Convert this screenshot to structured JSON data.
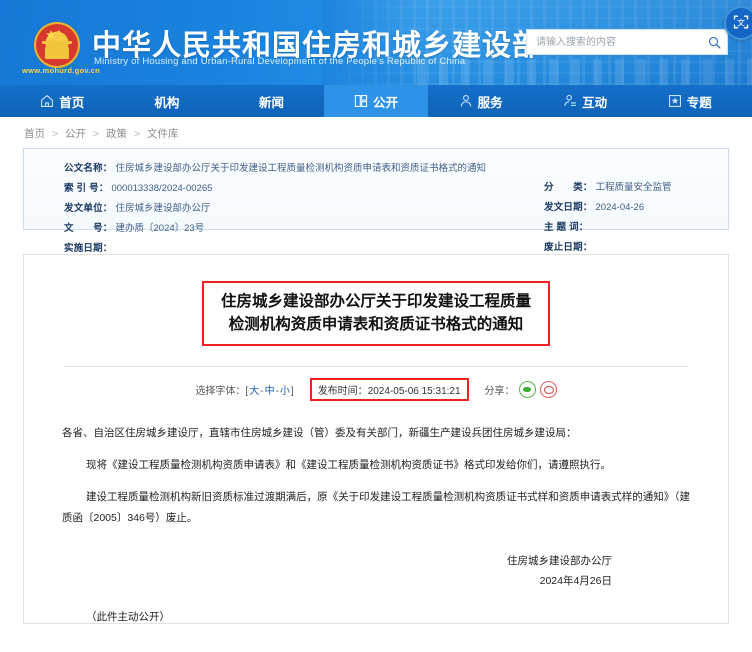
{
  "header": {
    "site_title": "中华人民共和国住房和城乡建设部",
    "site_subtitle": "Ministry of Housing and Urban-Rural Development of the People's Republic of China",
    "site_url": "www.mohurd.gov.cn",
    "emblem_name": "national-emblem",
    "search_placeholder": "请输入搜索的内容",
    "search_value": "",
    "search_icon": "search-icon",
    "corner_button_icon": "scan-text-icon",
    "corner_button_label": "文"
  },
  "nav": {
    "items": [
      {
        "label": "首页",
        "icon": "home-icon",
        "active": false
      },
      {
        "label": "机构",
        "icon": "none",
        "active": false
      },
      {
        "label": "新闻",
        "icon": "none",
        "active": false
      },
      {
        "label": "公开",
        "icon": "document-open-icon",
        "active": true
      },
      {
        "label": "服务",
        "icon": "user-service-icon",
        "active": false
      },
      {
        "label": "互动",
        "icon": "interaction-icon",
        "active": false
      },
      {
        "label": "专题",
        "icon": "star-box-icon",
        "active": false
      }
    ]
  },
  "breadcrumb": {
    "items": [
      "首页",
      "公开",
      "政策",
      "文件库"
    ],
    "separator": ">"
  },
  "meta": {
    "left": [
      {
        "label": "公文名称：",
        "value": "住房城乡建设部办公厅关于印发建设工程质量检测机构资质申请表和资质证书格式的通知"
      },
      {
        "label": "索 引 号：",
        "value": "000013338/2024-00265"
      },
      {
        "label": "发文单位：",
        "value": "住房城乡建设部办公厅"
      },
      {
        "label": "文　　号：",
        "value": "建办质〔2024〕23号"
      },
      {
        "label": "实施日期：",
        "value": ""
      }
    ],
    "right": [
      {
        "label": "分　　类：",
        "value": "工程质量安全监管"
      },
      {
        "label": "发文日期：",
        "value": "2024-04-26"
      },
      {
        "label": "主 题 词：",
        "value": ""
      },
      {
        "label": "废止日期：",
        "value": ""
      }
    ]
  },
  "document": {
    "title_line1": "住房城乡建设部办公厅关于印发建设工程质量",
    "title_line2": "检测机构资质申请表和资质证书格式的通知",
    "title_highlight_color": "#ef2020",
    "fontsize_label": "选择字体：[",
    "fontsize_large": "大",
    "fontsize_medium": "中",
    "fontsize_small": "小",
    "fontsize_sep1": "-",
    "fontsize_sep2": "-",
    "fontsize_close": "]",
    "publish_label": "发布时间：",
    "publish_time": "2024-05-06 15:31:21",
    "share_label": "分享：",
    "share_icons": [
      "wechat-icon",
      "weibo-icon"
    ],
    "paragraphs": [
      "各省、自治区住房城乡建设厅，直辖市住房城乡建设（管）委及有关部门，新疆生产建设兵团住房城乡建设局：",
      "现将《建设工程质量检测机构资质申请表》和《建设工程质量检测机构资质证书》格式印发给你们，请遵照执行。",
      "建设工程质量检测机构新旧资质标准过渡期满后，原《关于印发建设工程质量检测机构资质证书式样和资质申请表式样的通知》（建质函〔2005〕346号）废止。"
    ],
    "signature_org": "住房城乡建设部办公厅",
    "signature_date": "2024年4月26日",
    "footer_note": "（此件主动公开）"
  }
}
